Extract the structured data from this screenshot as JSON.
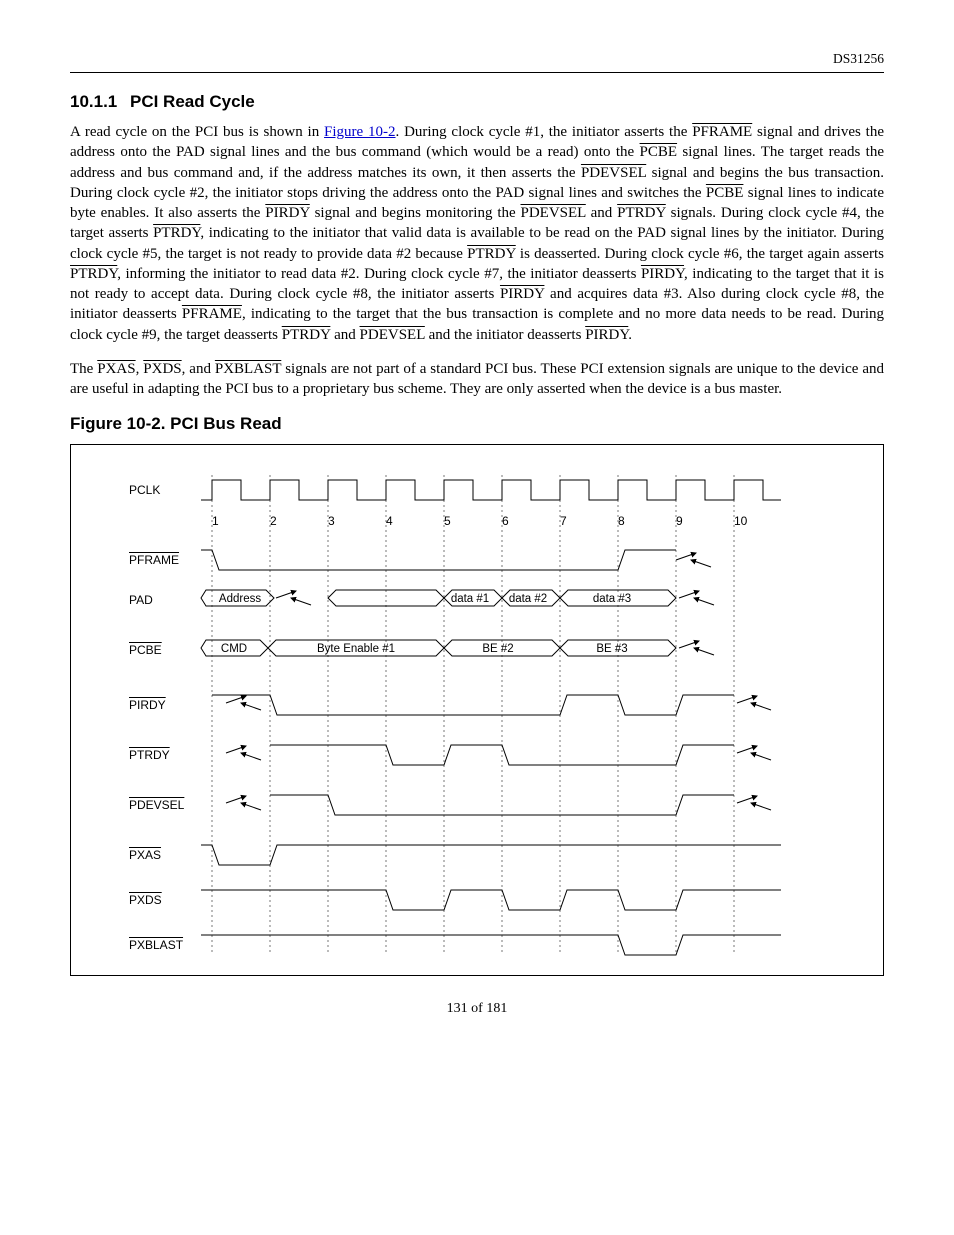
{
  "doc_id": "DS31256",
  "section": {
    "number": "10.1.1",
    "title": "PCI Read Cycle"
  },
  "paragraphs": {
    "p1_a": "A read cycle on the PCI bus is shown in ",
    "p1_link": "Figure 10-2",
    "p1_b": ". During clock cycle #1, the initiator asserts the ",
    "p1_c": " signal and drives the address onto the PAD signal lines and the bus command (which would be a read) onto the ",
    "p1_d": " signal lines. The target reads the address and bus command and, if the address matches its own, it then asserts the ",
    "p1_e": " signal and begins the bus transaction. During clock cycle #2, the initiator stops driving the address onto the PAD signal lines and switches the ",
    "p1_f": " signal lines to indicate byte enables. It also asserts the ",
    "p1_g": " signal and begins monitoring the ",
    "p1_h": " and ",
    "p1_i": " signals. During clock cycle #4, the target asserts ",
    "p1_j": ", indicating to the initiator that valid data is available to be read on the PAD signal lines by the initiator. During clock cycle #5, the target is not ready to provide data #2 because ",
    "p1_k": " is deasserted. During clock cycle #6, the target again asserts ",
    "p1_l": ", informing the initiator to read data #2. During clock cycle #7, the initiator deasserts ",
    "p1_m": ", indicating to the target that it is not ready to accept data. During clock cycle #8, the initiator asserts ",
    "p1_n": " and acquires data #3. Also during clock cycle #8, the initiator deasserts ",
    "p1_o": ", indicating to the target that the bus transaction is complete and no more data needs to be read. During clock cycle #9, the target deasserts ",
    "p1_p": " and ",
    "p1_q": " and the initiator deasserts ",
    "p1_r": ".",
    "p2_a": "The ",
    "p2_b": ", ",
    "p2_c": ", and ",
    "p2_d": " signals are not part of a standard PCI bus. These PCI extension signals are unique to the device and are useful in adapting the PCI bus to a proprietary bus scheme. They are only asserted when the device is a bus master."
  },
  "signals": {
    "PFRAME": "PFRAME",
    "PCBE": "PCBE",
    "PDEVSEL": "PDEVSEL",
    "PIRDY": "PIRDY",
    "PTRDY": "PTRDY",
    "PXAS": "PXAS",
    "PXDS": "PXDS",
    "PXBLAST": "PXBLAST"
  },
  "figure": {
    "title": "Figure 10-2. PCI Bus Read",
    "rows": {
      "pclk": "PCLK",
      "pframe": "PFRAME",
      "pad": "PAD",
      "pcbe": "PCBE",
      "pirdy": "PIRDY",
      "ptrdy": "PTRDY",
      "pdevsel": "PDEVSEL",
      "pxas": "PXAS",
      "pxds": "PXDS",
      "pxblast": "PXBLAST"
    },
    "clock_numbers": [
      "1",
      "2",
      "3",
      "4",
      "5",
      "6",
      "7",
      "8",
      "9",
      "10"
    ],
    "pad": {
      "address": "Address",
      "d1": "data #1",
      "d2": "data #2",
      "d3": "data #3"
    },
    "pcbe": {
      "cmd": "CMD",
      "be1": "Byte Enable #1",
      "be2": "BE #2",
      "be3": "BE #3"
    }
  },
  "footer": "131 of 181"
}
